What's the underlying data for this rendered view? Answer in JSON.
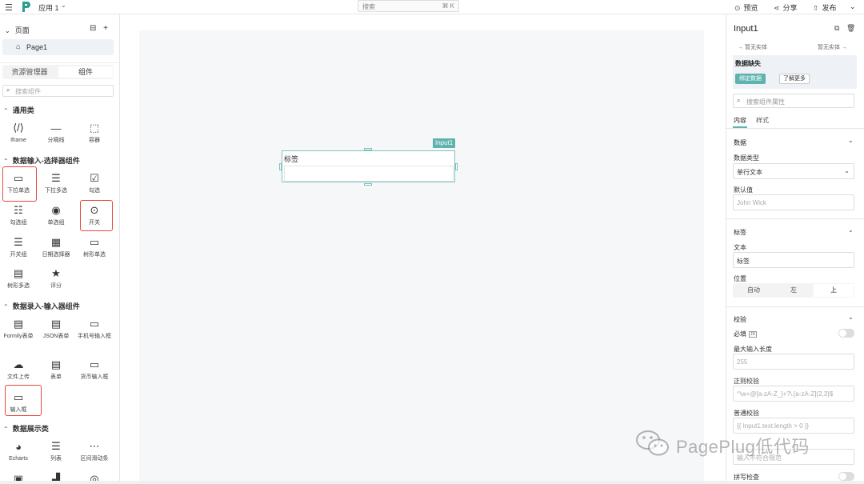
{
  "topbar": {
    "app_name": "应用 1",
    "search_placeholder": "搜索",
    "search_shortcut": "⌘ K",
    "preview": "预览",
    "share": "分享",
    "publish": "发布"
  },
  "left": {
    "pages_header": "页面",
    "page1": "Page1",
    "tab_assets": "资源管理器",
    "tab_components": "组件",
    "search_placeholder": "搜索组件",
    "sections": {
      "general": "通用类",
      "select": "数据输入-选择器组件",
      "input": "数据录入-输入器组件",
      "display": "数据展示类"
    },
    "general_items": [
      "Iframe",
      "分隔线",
      "容器"
    ],
    "select_items": [
      "下拉单选",
      "下拉多选",
      "勾选",
      "勾选组",
      "单选组",
      "开关",
      "开关组",
      "日期选择器",
      "树形单选",
      "树形多选",
      "评分"
    ],
    "input_items": [
      "Formily表单",
      "JSON表单",
      "手机号输入框",
      "文件上传",
      "表单",
      "货币输入框",
      "输入框"
    ],
    "display_items": [
      "Echarts",
      "列表",
      "区间滑动条"
    ]
  },
  "canvas": {
    "widget_tag": "Input1",
    "widget_label": "标签"
  },
  "right": {
    "title": "Input1",
    "nav_prev": "→ 暂无实体",
    "nav_next": "暂无实体 →",
    "alert_title": "数据缺失",
    "alert_bind": "绑定数据",
    "alert_more": "了解更多",
    "search_placeholder": "搜索组件属性",
    "tab_content": "内容",
    "tab_style": "样式",
    "data_section": "数据",
    "data_type_label": "数据类型",
    "data_type_value": "单行文本",
    "default_label": "默认值",
    "default_placeholder": "John Wick",
    "label_section": "标签",
    "text_label": "文本",
    "text_value": "标签",
    "position_label": "位置",
    "position_options": [
      "自动",
      "左",
      "上"
    ],
    "validation_section": "校验",
    "required_label": "必填",
    "js_badge": "JS",
    "maxlen_label": "最大输入长度",
    "maxlen_placeholder": "255",
    "regex_label": "正则校验",
    "regex_placeholder": "^\\w+@[a-zA-Z_]+?\\.[a-zA-Z]{2,3}$",
    "common_label": "普通校验",
    "common_placeholder": "{{ Input1.text.length > 0 }}",
    "err_placeholder": "输入不符合规范",
    "spell_label": "拼写检查"
  },
  "watermark": "PagePlug低代码"
}
